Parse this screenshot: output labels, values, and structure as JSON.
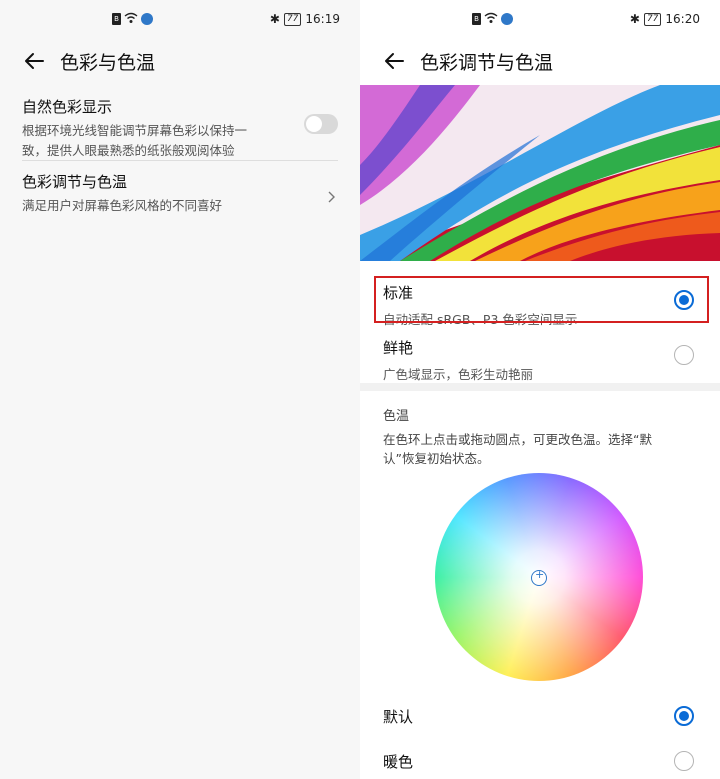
{
  "left": {
    "status": {
      "sim": "B",
      "time": "16:19",
      "battery": "77"
    },
    "title": "色彩与色温",
    "natural_color": {
      "title": "自然色彩显示",
      "subtitle_line1": "根据环境光线智能调节屏幕色彩以保持一",
      "subtitle_line2": "致，提供人眼最熟悉的纸张般观阅体验",
      "enabled": false
    },
    "color_adjust": {
      "title": "色彩调节与色温",
      "subtitle": "满足用户对屏幕色彩风格的不同喜好"
    }
  },
  "right": {
    "status": {
      "sim": "B",
      "time": "16:20",
      "battery": "77"
    },
    "title": "色彩调节与色温",
    "modes": [
      {
        "title": "标准",
        "subtitle": "自动适配 sRGB、P3 色彩空间显示",
        "selected": true
      },
      {
        "title": "鲜艳",
        "subtitle": "广色域显示，色彩生动艳丽",
        "selected": false
      }
    ],
    "color_temp": {
      "label": "色温",
      "description_line1": "在色环上点击或拖动圆点，可更改色温。选择“默",
      "description_line2": "认”恢复初始状态。"
    },
    "temp_options": [
      {
        "title": "默认",
        "selected": true
      },
      {
        "title": "暖色",
        "selected": false
      }
    ]
  },
  "colors": {
    "accent": "#0a6bd6",
    "highlight": "#d42020"
  }
}
